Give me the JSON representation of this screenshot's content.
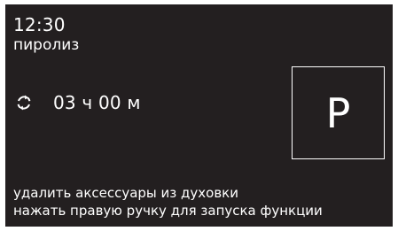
{
  "display": {
    "clock": "12:30",
    "mode": "пиролиз",
    "duration": "03 ч 00 м",
    "duration_icon": "cycle-arrows-icon",
    "program_letter": "P",
    "instructions": [
      "удалить аксессуары из духовки",
      "нажать правую ручку для запуска функции"
    ]
  },
  "colors": {
    "screen_background": "#231f20",
    "text": "#ffffff"
  }
}
